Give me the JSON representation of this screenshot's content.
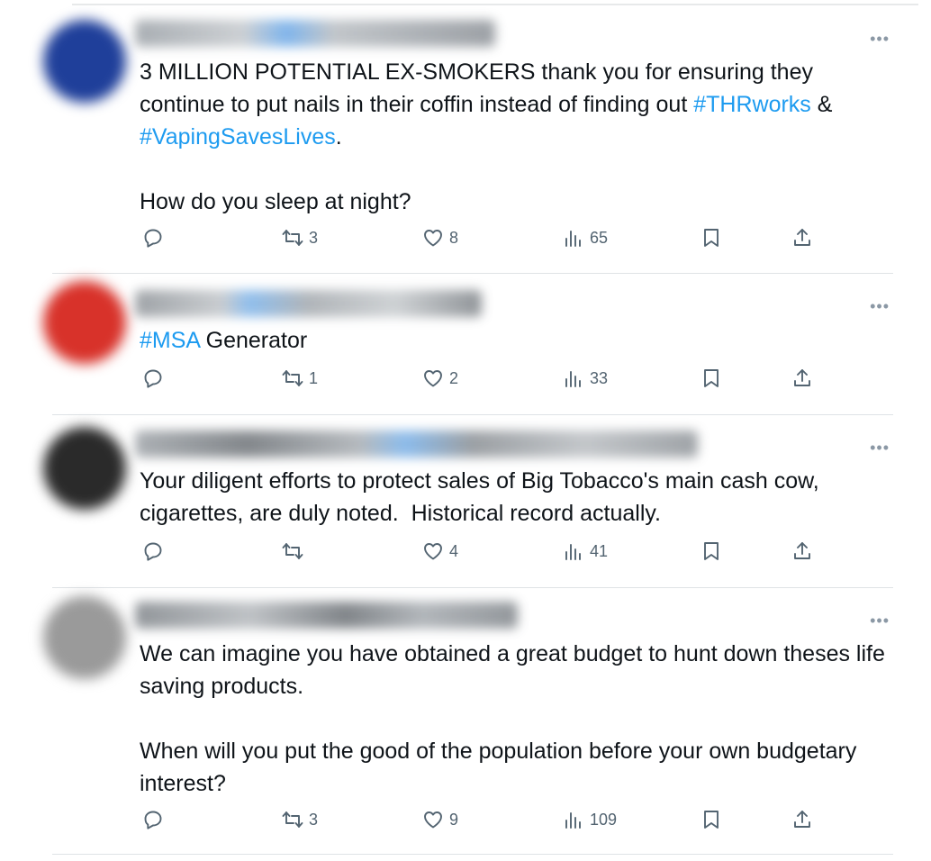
{
  "tweets": [
    {
      "text_prefix": "3 MILLION POTENTIAL EX-SMOKERS thank you for ensuring they continue to put nails in their coffin instead of finding out ",
      "hashtag1": "#THRworks",
      "text_mid": " & ",
      "hashtag2": "#VapingSavesLives",
      "text_suffix": ".\n\nHow do you sleep at night?",
      "retweets": "3",
      "likes": "8",
      "views": "65",
      "avatar_color": "#1f3f9a"
    },
    {
      "hashtag1": "#MSA",
      "text_suffix": " Generator",
      "retweets": "1",
      "likes": "2",
      "views": "33",
      "avatar_color": "#d8322a"
    },
    {
      "text": "Your diligent efforts to protect sales of Big Tobacco's main cash cow, cigarettes, are duly noted.  Historical record actually.",
      "retweets": "",
      "likes": "4",
      "views": "41",
      "avatar_color": "#2a2a2a"
    },
    {
      "text": "We can imagine you have obtained a great budget to hunt down theses life saving products.\n\nWhen will you put the good of the population before your own budgetary interest?",
      "retweets": "3",
      "likes": "9",
      "views": "109",
      "avatar_color": "#9a9a9a"
    }
  ],
  "colors": {
    "hashtag": "#1d9bf0",
    "icon": "#536471",
    "divider": "#dfe3e6"
  },
  "icons": [
    "reply-icon",
    "retweet-icon",
    "like-icon",
    "views-icon",
    "bookmark-icon",
    "share-icon",
    "more-icon"
  ]
}
